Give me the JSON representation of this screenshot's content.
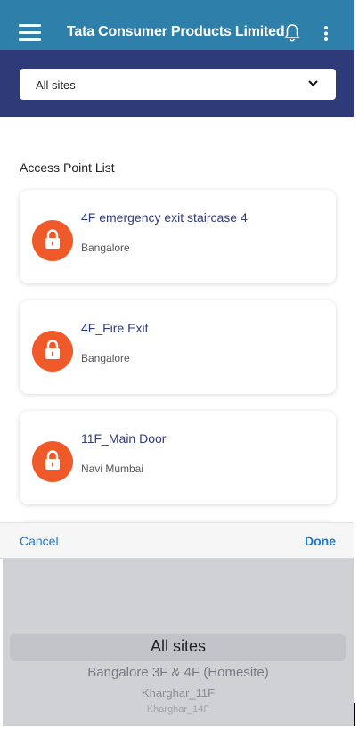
{
  "app": {
    "title": "Tata Consumer Products Limited"
  },
  "site_selector": {
    "value": "All sites"
  },
  "access_points": {
    "heading": "Access Point List",
    "items": [
      {
        "name": "4F emergency exit staircase 4",
        "location": "Bangalore"
      },
      {
        "name": "4F_Fire Exit",
        "location": "Bangalore"
      },
      {
        "name": "11F_Main Door",
        "location": "Navi Mumbai"
      }
    ]
  },
  "picker": {
    "cancel_label": "Cancel",
    "done_label": "Done",
    "options": [
      "All sites",
      "Bangalore 3F & 4F (Homesite)",
      "Kharghar_11F",
      "Kharghar_14F"
    ],
    "selected": "All sites"
  },
  "colors": {
    "appbar": "#2f7fab",
    "selector_band": "#2f3a79",
    "lock_badge": "#f05a2a",
    "link": "#1a7ad6"
  },
  "icons": {
    "menu": "menu-icon",
    "bell": "bell-icon",
    "more": "kebab-icon",
    "dropdown": "chevron-down-icon",
    "lock": "lock-icon"
  }
}
